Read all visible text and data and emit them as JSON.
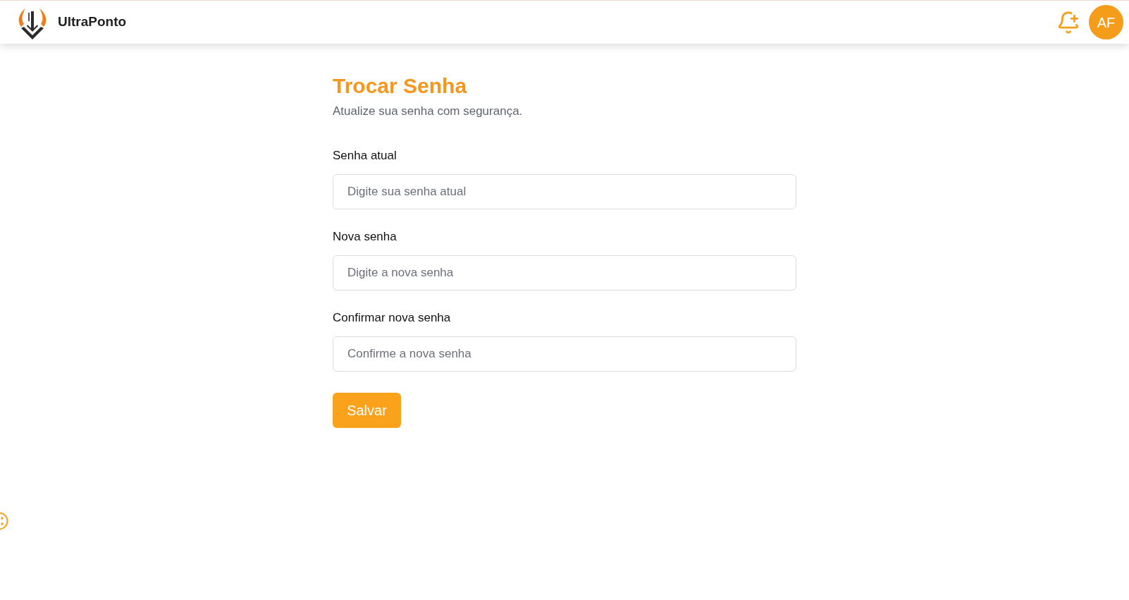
{
  "header": {
    "brand": "UltraPonto",
    "avatar_initials": "AF"
  },
  "page": {
    "title": "Trocar Senha",
    "subtitle": "Atualize sua senha com segurança."
  },
  "fields": [
    {
      "label": "Senha atual",
      "placeholder": "Digite sua senha atual"
    },
    {
      "label": "Nova senha",
      "placeholder": "Digite a nova senha"
    },
    {
      "label": "Confirmar nova senha",
      "placeholder": "Confirme a nova senha"
    }
  ],
  "submit_button": "Salvar"
}
